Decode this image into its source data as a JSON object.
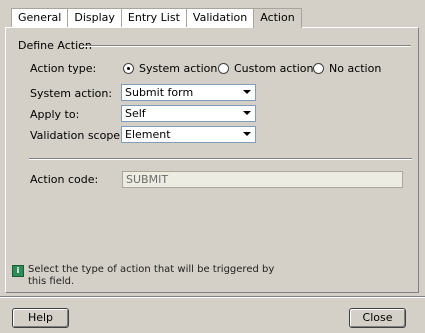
{
  "tabs": [
    {
      "label": "General"
    },
    {
      "label": "Display"
    },
    {
      "label": "Entry List"
    },
    {
      "label": "Validation"
    },
    {
      "label": "Action",
      "active": true
    }
  ],
  "group": {
    "title": "Define Action"
  },
  "action_type": {
    "label": "Action type:",
    "options": [
      {
        "label": "System action",
        "checked": true
      },
      {
        "label": "Custom action",
        "checked": false
      },
      {
        "label": "No action",
        "checked": false
      }
    ]
  },
  "system_action": {
    "label": "System action:",
    "value": "Submit form"
  },
  "apply_to": {
    "label": "Apply to:",
    "value": "Self"
  },
  "validation_scope": {
    "label": "Validation scope:",
    "value": "Element"
  },
  "action_code": {
    "label": "Action code:",
    "value": "SUBMIT"
  },
  "info": {
    "icon": "info-icon",
    "text": "Select the type of action that will be triggered by this field."
  },
  "buttons": {
    "help": "Help",
    "close": "Close"
  }
}
